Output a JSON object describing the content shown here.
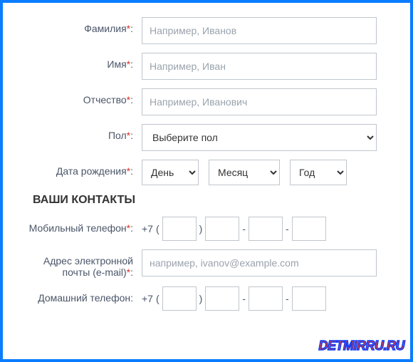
{
  "fields": {
    "lastname": {
      "label": "Фамилия",
      "placeholder": "Например, Иванов"
    },
    "firstname": {
      "label": "Имя",
      "placeholder": "Например, Иван"
    },
    "patronymic": {
      "label": "Отчество",
      "placeholder": "Например, Иванович"
    },
    "gender": {
      "label": "Пол",
      "placeholder": "Выберите пол"
    },
    "birthdate": {
      "label": "Дата рождения",
      "day": "День",
      "month": "Месяц",
      "year": "Год"
    },
    "mobile": {
      "label": "Мобильный телефон",
      "prefix": "+7"
    },
    "email": {
      "label": "Адрес электронной почты (e-mail)",
      "placeholder": "например, ivanov@example.com"
    },
    "home": {
      "label": "Домашний телефон:",
      "prefix": "+7"
    }
  },
  "symbols": {
    "required": "*",
    "colon": ":",
    "open": "(",
    "close": ")",
    "dash": "-"
  },
  "section": {
    "contacts": "ВАШИ КОНТАКТЫ"
  },
  "watermark": "DETMIRRU.RU"
}
